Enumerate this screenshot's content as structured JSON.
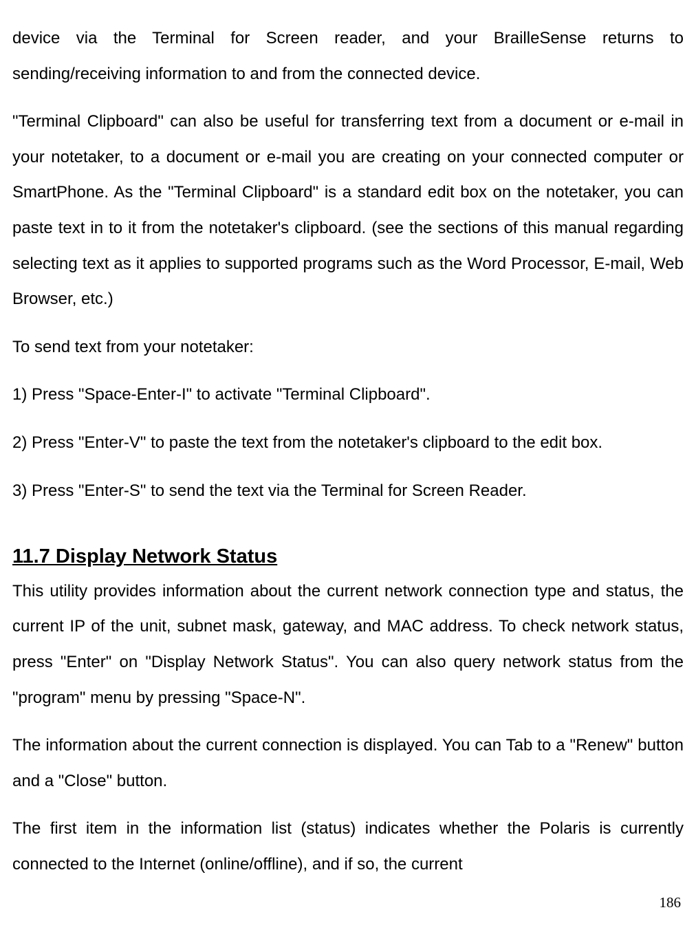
{
  "paragraphs": {
    "p1": "device via the Terminal for Screen reader, and your BrailleSense returns to sending/receiving information to and from the connected device.",
    "p2": "\"Terminal Clipboard\" can also be useful for transferring text from a document or e-mail in your notetaker, to a document or e-mail you are creating on your connected computer or SmartPhone. As the \"Terminal Clipboard\" is a standard edit box on the notetaker, you can paste text in to it from the notetaker's clipboard. (see the sections of this manual regarding selecting text as it applies to supported programs such as the Word Processor, E-mail, Web Browser, etc.)",
    "p3": "To send text from your notetaker:",
    "step1": "1) Press \"Space-Enter-I\" to activate \"Terminal Clipboard\".",
    "step2": "2) Press \"Enter-V\" to paste the text from the notetaker's clipboard to the edit box.",
    "step3": "3) Press \"Enter-S\" to send the text via the Terminal for Screen Reader.",
    "p4": "This utility provides information about the current network connection type and status, the current IP of the unit, subnet mask, gateway, and MAC address. To check network status, press \"Enter\" on \"Display Network Status\". You can also query network status from the \"program\" menu by pressing \"Space-N\".",
    "p5": "The information about the current connection is displayed. You can Tab to a \"Renew\" button and a \"Close\" button.",
    "p6": "The first item in the information list (status) indicates whether the Polaris is currently connected to the Internet (online/offline), and if so, the current"
  },
  "heading": "11.7 Display Network Status",
  "page_number": "186"
}
